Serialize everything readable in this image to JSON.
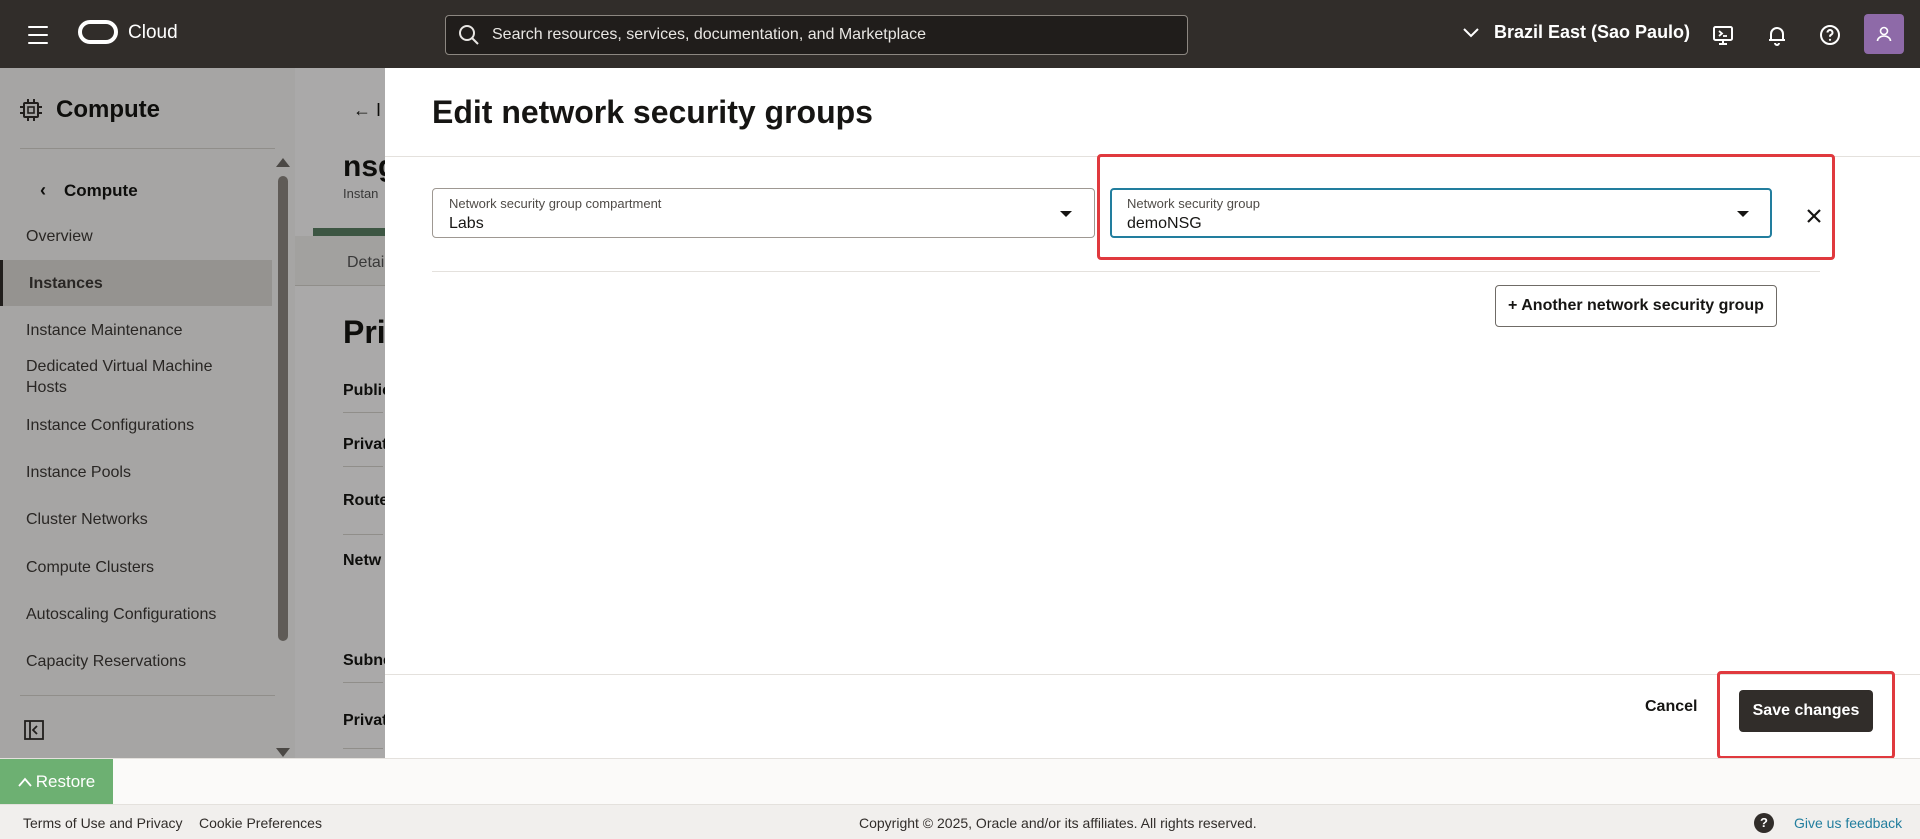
{
  "topbar": {
    "brand": "Cloud",
    "search_placeholder": "Search resources, services, documentation, and Marketplace",
    "region": "Brazil East (Sao Paulo)"
  },
  "sidebar": {
    "header": "Compute",
    "back_label": "Compute",
    "items": [
      {
        "label": "Overview"
      },
      {
        "label": "Instances",
        "active": true
      },
      {
        "label": "Instance Maintenance"
      },
      {
        "label": "Dedicated Virtual Machine Hosts"
      },
      {
        "label": "Instance Configurations"
      },
      {
        "label": "Instance Pools"
      },
      {
        "label": "Cluster Networks"
      },
      {
        "label": "Compute Clusters"
      },
      {
        "label": "Autoscaling Configurations"
      },
      {
        "label": "Capacity Reservations"
      }
    ]
  },
  "background": {
    "back_text": "I",
    "title": "nsg",
    "subtitle": "Instan",
    "tab": "Detai",
    "heading": "Pri",
    "labels": [
      "Public",
      "Privat",
      "Route",
      "Netw",
      "Subne",
      "Privat"
    ]
  },
  "panel": {
    "title": "Edit network security groups",
    "compartment_label": "Network security group compartment",
    "compartment_value": "Labs",
    "nsg_label": "Network security group",
    "nsg_value": "demoNSG",
    "another_button": "+ Another network security group",
    "cancel_button": "Cancel",
    "save_button": "Save changes"
  },
  "restore": {
    "label": "Restore"
  },
  "footer": {
    "terms": "Terms of Use and Privacy",
    "cookies": "Cookie Preferences",
    "copyright": "Copyright © 2025, Oracle and/or its affiliates. All rights reserved.",
    "feedback": "Give us feedback"
  },
  "colors": {
    "topbar": "#312d2a",
    "highlight": "#e0393e",
    "focus": "#227e9e",
    "restore": "#6db072"
  }
}
